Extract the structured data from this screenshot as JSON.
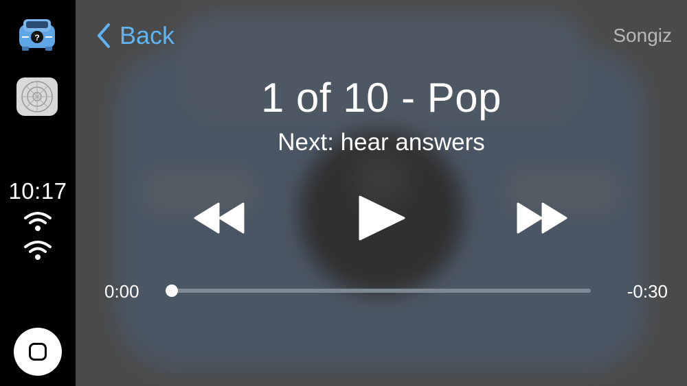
{
  "sidebar": {
    "clock": "10:17",
    "apps": [
      {
        "name": "songiz-app-icon"
      },
      {
        "name": "settings-app-icon"
      }
    ],
    "status_icons": [
      "wifi-icon",
      "wifi-icon"
    ]
  },
  "header": {
    "back_label": "Back",
    "app_name": "Songiz"
  },
  "now_playing": {
    "title": "1 of 10 - Pop",
    "subtitle": "Next: hear answers",
    "elapsed": "0:00",
    "remaining": "-0:30",
    "progress": 0.0
  },
  "controls": {
    "rewind_icon": "rewind-icon",
    "play_icon": "play-icon",
    "fast_forward_icon": "fast-forward-icon"
  },
  "colors": {
    "accent": "#5fb4f4",
    "background": "#4a4a4a",
    "sidebar": "#000000",
    "text": "#ffffff",
    "muted_text": "#b8b8b8"
  }
}
